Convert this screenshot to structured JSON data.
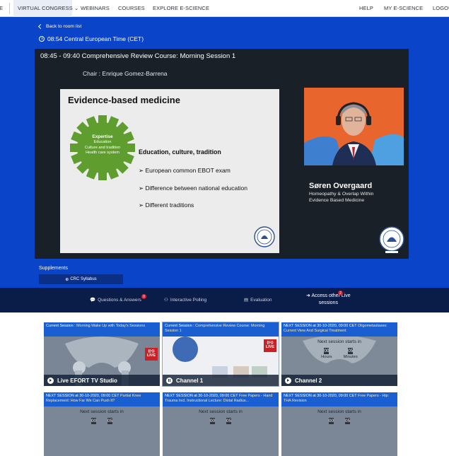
{
  "nav": {
    "items": [
      "VIRTUAL CONGRESS",
      "WEBINARS",
      "COURSES",
      "EXPLORE E-SCIENCE"
    ],
    "right": [
      "HELP",
      "MY E-SCIENCE",
      "LOGOUT"
    ]
  },
  "session": {
    "back": "Back to room list",
    "time": "08:54 Central European Time (CET)",
    "title": "08:45 - 09:40  Comprehensive Review Course: Morning Session 1",
    "chair": "Chair : Enrique Gomez-Barrena"
  },
  "slide": {
    "title": "Evidence-based medicine",
    "gear_bold": "Expertise",
    "gear_lines": [
      "Education",
      "Culture and tradition",
      "Health care system"
    ],
    "heading": "Education, culture, tradition",
    "bullets": [
      "European common EBOT exam",
      "Difference between national education",
      "Different  traditions"
    ]
  },
  "speaker": {
    "name": "Søren Overgaard",
    "topic_line1": "Homeopathy & Overlap Within",
    "topic_line2": "Evidence Based Medicine"
  },
  "supplements": {
    "label": "Supplements",
    "button": "CRC Syllabus"
  },
  "actions": {
    "qa": "Questions & Answers",
    "qa_badge": "0",
    "polling": "Interactive Polling",
    "evaluation": "Evaluation",
    "access_line1": "Access other Live",
    "access_line2": "sessions",
    "access_badge": "2"
  },
  "channels": [
    {
      "prefix": "Current Session : ",
      "title": "Morning Wake Up with Today's Sessions",
      "label": "Live EFORT TV Studio",
      "live": "LIVE"
    },
    {
      "prefix": "Current Session : ",
      "title": "Comprehensive Review Course: Morning Session 1",
      "label": "Channel 1",
      "live": "LIVE"
    },
    {
      "prefix": "NEXT SESSION at 30-10-2020, 09:00 CET ",
      "title": "Oligometastases: Current View And Surgical Treatment",
      "label": "Channel 2",
      "next": "Next session starts in",
      "hours": "00",
      "minutes": "05",
      "hours_label": "Hours",
      "minutes_label": "Minutes"
    },
    {
      "prefix": "NEXT SESSION at 30-10-2020, 09:00 CET ",
      "title": "Partial Knee Replacement: How Far We Can Push It?",
      "next": "Next session starts in",
      "hours": "00",
      "minutes": "05"
    },
    {
      "prefix": "NEXT SESSION at 30-10-2020, 09:00 CET ",
      "title": "Free Papers - Hand Trauma Incl. Instructional Lecture: Distal Radius...",
      "next": "Next session starts in",
      "hours": "00",
      "minutes": "05"
    },
    {
      "prefix": "NEXT SESSION at 30-10-2020, 09:00 CET ",
      "title": "Free Papers - Hip: THA Revision",
      "next": "Next session starts in",
      "hours": "00",
      "minutes": "05"
    }
  ],
  "colors": {
    "brand_blue": "#0a44c9",
    "navy": "#0a1d49",
    "live_red": "#c91f25"
  }
}
